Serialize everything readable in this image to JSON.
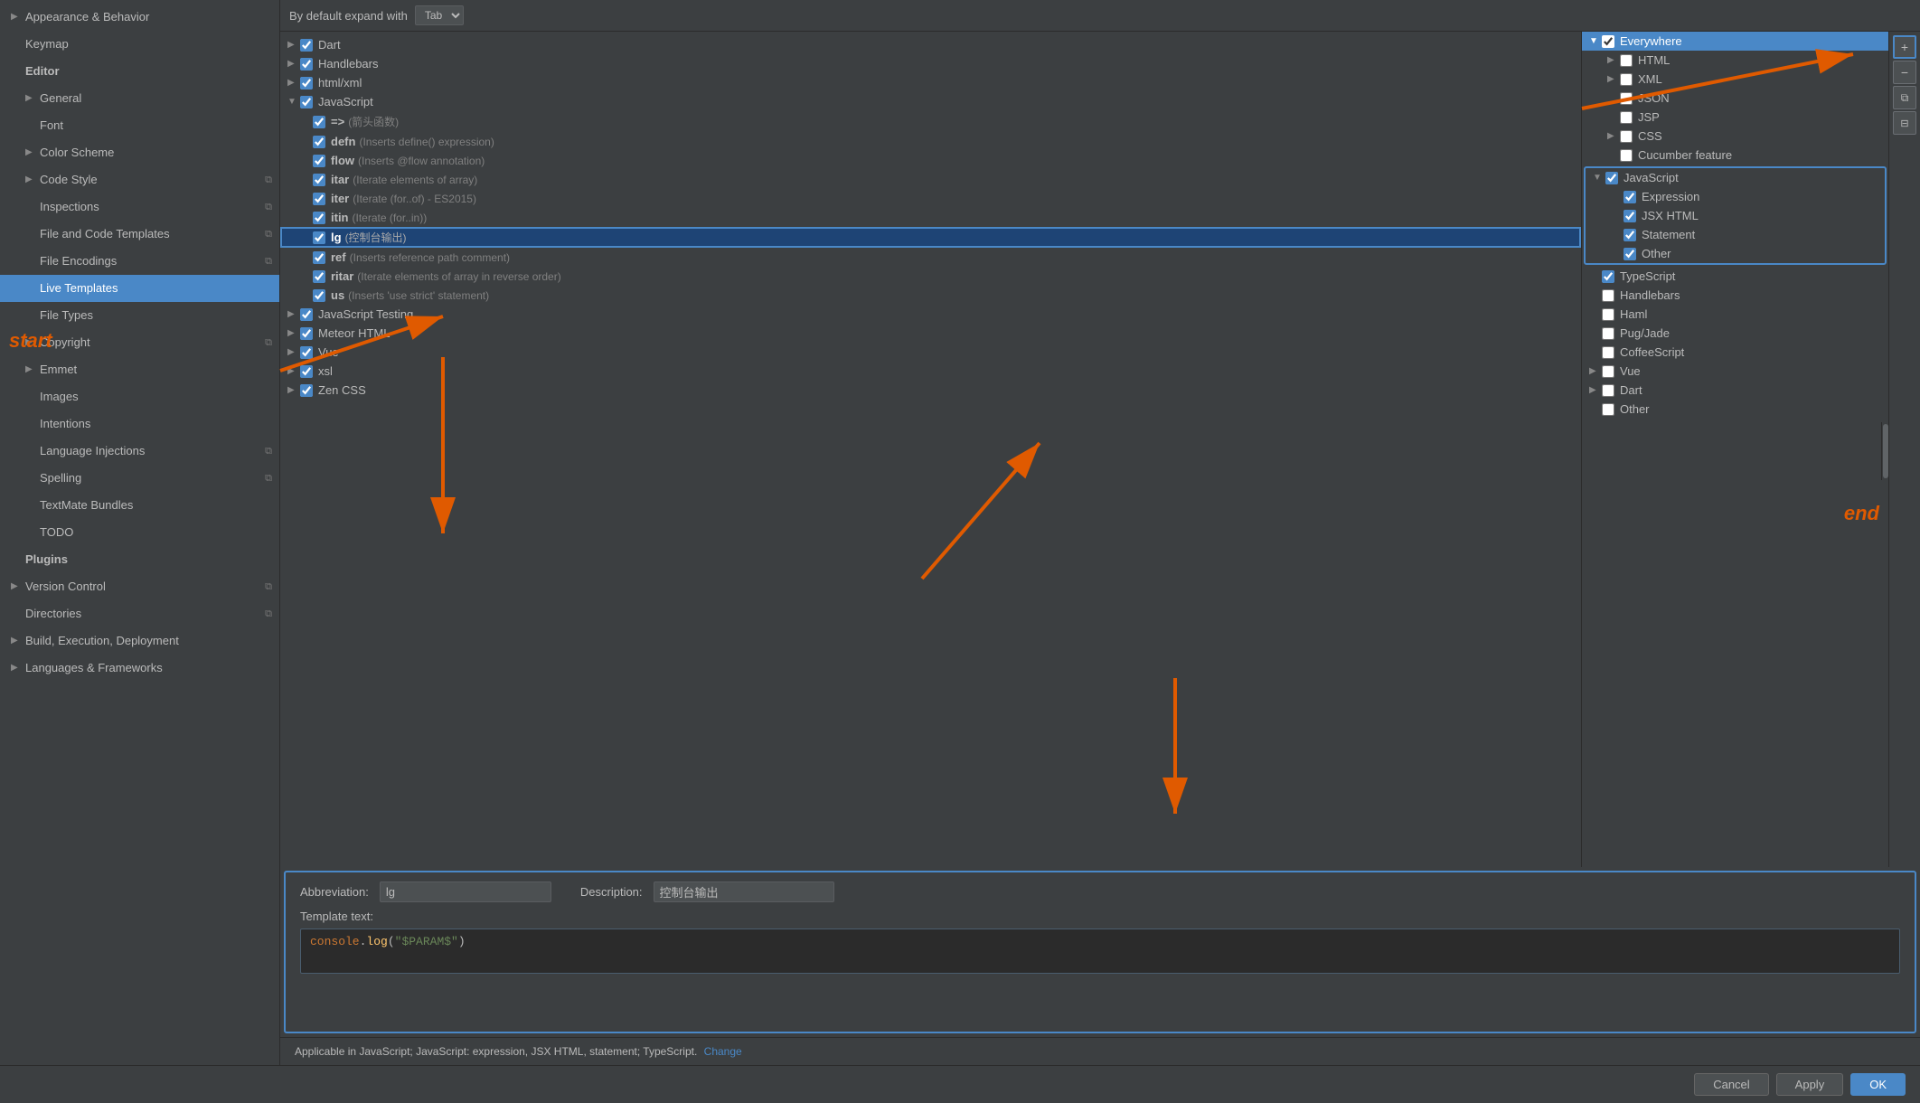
{
  "sidebar": {
    "items": [
      {
        "id": "appearance",
        "label": "Appearance & Behavior",
        "indent": 0,
        "arrow": "▶",
        "active": false
      },
      {
        "id": "keymap",
        "label": "Keymap",
        "indent": 0,
        "arrow": "",
        "active": false
      },
      {
        "id": "editor",
        "label": "Editor",
        "indent": 0,
        "arrow": "",
        "active": false,
        "bold": true
      },
      {
        "id": "general",
        "label": "General",
        "indent": 1,
        "arrow": "▶",
        "active": false
      },
      {
        "id": "font",
        "label": "Font",
        "indent": 1,
        "arrow": "",
        "active": false
      },
      {
        "id": "color-scheme",
        "label": "Color Scheme",
        "indent": 1,
        "arrow": "▶",
        "active": false
      },
      {
        "id": "code-style",
        "label": "Code Style",
        "indent": 1,
        "arrow": "▶",
        "active": false,
        "copy": true
      },
      {
        "id": "inspections",
        "label": "Inspections",
        "indent": 1,
        "arrow": "",
        "active": false,
        "copy": true
      },
      {
        "id": "file-templates",
        "label": "File and Code Templates",
        "indent": 1,
        "arrow": "",
        "active": false,
        "copy": true
      },
      {
        "id": "file-encodings",
        "label": "File Encodings",
        "indent": 1,
        "arrow": "",
        "active": false,
        "copy": true
      },
      {
        "id": "live-templates",
        "label": "Live Templates",
        "indent": 1,
        "arrow": "",
        "active": true
      },
      {
        "id": "file-types",
        "label": "File Types",
        "indent": 1,
        "arrow": "",
        "active": false
      },
      {
        "id": "copyright",
        "label": "Copyright",
        "indent": 1,
        "arrow": "▶",
        "active": false,
        "copy": true
      },
      {
        "id": "emmet",
        "label": "Emmet",
        "indent": 1,
        "arrow": "▶",
        "active": false
      },
      {
        "id": "images",
        "label": "Images",
        "indent": 1,
        "arrow": "",
        "active": false
      },
      {
        "id": "intentions",
        "label": "Intentions",
        "indent": 1,
        "arrow": "",
        "active": false
      },
      {
        "id": "language-injections",
        "label": "Language Injections",
        "indent": 1,
        "arrow": "",
        "active": false,
        "copy": true
      },
      {
        "id": "spelling",
        "label": "Spelling",
        "indent": 1,
        "arrow": "",
        "active": false,
        "copy": true
      },
      {
        "id": "textmate",
        "label": "TextMate Bundles",
        "indent": 1,
        "arrow": "",
        "active": false
      },
      {
        "id": "todo",
        "label": "TODO",
        "indent": 1,
        "arrow": "",
        "active": false
      },
      {
        "id": "plugins",
        "label": "Plugins",
        "indent": 0,
        "arrow": "",
        "active": false,
        "bold": true
      },
      {
        "id": "version-control",
        "label": "Version Control",
        "indent": 0,
        "arrow": "▶",
        "active": false,
        "copy": true
      },
      {
        "id": "directories",
        "label": "Directories",
        "indent": 0,
        "arrow": "",
        "active": false,
        "copy": true
      },
      {
        "id": "build",
        "label": "Build, Execution, Deployment",
        "indent": 0,
        "arrow": "▶",
        "active": false
      },
      {
        "id": "languages",
        "label": "Languages & Frameworks",
        "indent": 0,
        "arrow": "▶",
        "active": false
      }
    ]
  },
  "topbar": {
    "label": "By default expand with",
    "select_value": "Tab"
  },
  "template_groups": [
    {
      "id": "dart",
      "label": "Dart",
      "checked": true,
      "expanded": false
    },
    {
      "id": "handlebars",
      "label": "Handlebars",
      "checked": true,
      "expanded": false
    },
    {
      "id": "html-xml",
      "label": "html/xml",
      "checked": true,
      "expanded": false
    },
    {
      "id": "javascript",
      "label": "JavaScript",
      "checked": true,
      "expanded": true,
      "items": [
        {
          "abbr": "=>",
          "desc": "(箭头函数)",
          "checked": true,
          "selected": false
        },
        {
          "abbr": "defn",
          "desc": "(Inserts define() expression)",
          "checked": true,
          "selected": false
        },
        {
          "abbr": "flow",
          "desc": "(Inserts @flow annotation)",
          "checked": true,
          "selected": false
        },
        {
          "abbr": "itar",
          "desc": "(Iterate elements of array)",
          "checked": true,
          "selected": false
        },
        {
          "abbr": "iter",
          "desc": "(Iterate (for..of) - ES2015)",
          "checked": true,
          "selected": false
        },
        {
          "abbr": "itin",
          "desc": "(Iterate (for..in))",
          "checked": true,
          "selected": false
        },
        {
          "abbr": "lg",
          "desc": "(控制台输出)",
          "checked": true,
          "selected": true
        },
        {
          "abbr": "ref",
          "desc": "(Inserts reference path comment)",
          "checked": true,
          "selected": false
        },
        {
          "abbr": "ritar",
          "desc": "(Iterate elements of array in reverse order)",
          "checked": true,
          "selected": false
        },
        {
          "abbr": "us",
          "desc": "(Inserts 'use strict' statement)",
          "checked": true,
          "selected": false
        }
      ]
    },
    {
      "id": "js-testing",
      "label": "JavaScript Testing",
      "checked": true,
      "expanded": false
    },
    {
      "id": "meteor-html",
      "label": "Meteor HTML",
      "checked": true,
      "expanded": false
    },
    {
      "id": "vue",
      "label": "Vue",
      "checked": true,
      "expanded": false
    },
    {
      "id": "xsl",
      "label": "xsl",
      "checked": true,
      "expanded": false
    },
    {
      "id": "zen-css",
      "label": "Zen CSS",
      "checked": true,
      "expanded": false
    }
  ],
  "detail": {
    "abbreviation_label": "Abbreviation:",
    "abbreviation_value": "lg",
    "description_label": "Description:",
    "description_value": "控制台输出",
    "template_text_label": "Template text:",
    "template_text": "console.log(\"$PARAM$\")"
  },
  "applicable": {
    "text": "Applicable in JavaScript; JavaScript: expression, JSX HTML, statement; TypeScript.",
    "link_text": "Change"
  },
  "applicability_tree": [
    {
      "id": "everywhere",
      "label": "Everywhere",
      "checked": true,
      "expanded": true,
      "active": true,
      "children": [
        {
          "id": "html",
          "label": "HTML",
          "checked": false,
          "expanded": true
        },
        {
          "id": "xml",
          "label": "XML",
          "checked": false,
          "expanded": false
        },
        {
          "id": "json",
          "label": "JSON",
          "checked": false,
          "expanded": false
        },
        {
          "id": "jsp",
          "label": "JSP",
          "checked": false,
          "expanded": false
        },
        {
          "id": "css",
          "label": "CSS",
          "checked": false,
          "expanded": true
        },
        {
          "id": "cucumber",
          "label": "Cucumber feature",
          "checked": false,
          "expanded": false
        }
      ]
    },
    {
      "id": "javascript-ctx",
      "label": "JavaScript",
      "checked": true,
      "expanded": true,
      "children": [
        {
          "id": "expression",
          "label": "Expression",
          "checked": true,
          "expanded": false
        },
        {
          "id": "jsx-html",
          "label": "JSX HTML",
          "checked": true,
          "expanded": false
        },
        {
          "id": "statement",
          "label": "Statement",
          "checked": true,
          "expanded": false
        },
        {
          "id": "other",
          "label": "Other",
          "checked": true,
          "expanded": false
        }
      ]
    },
    {
      "id": "typescript",
      "label": "TypeScript",
      "checked": true,
      "expanded": false
    },
    {
      "id": "handlebars-ctx",
      "label": "Handlebars",
      "checked": false,
      "expanded": false
    },
    {
      "id": "haml",
      "label": "Haml",
      "checked": false,
      "expanded": false
    },
    {
      "id": "pug",
      "label": "Pug/Jade",
      "checked": false,
      "expanded": false
    },
    {
      "id": "coffeescript",
      "label": "CoffeeScript",
      "checked": false,
      "expanded": false
    },
    {
      "id": "vue-ctx",
      "label": "Vue",
      "checked": false,
      "expanded": true
    },
    {
      "id": "dart-ctx",
      "label": "Dart",
      "checked": false,
      "expanded": true
    },
    {
      "id": "other-ctx",
      "label": "Other",
      "checked": false,
      "expanded": false
    }
  ],
  "toolbar_buttons": [
    {
      "id": "add",
      "label": "+",
      "tooltip": "Add"
    },
    {
      "id": "remove",
      "label": "−",
      "tooltip": "Remove"
    },
    {
      "id": "copy",
      "label": "⧉",
      "tooltip": "Copy"
    },
    {
      "id": "expand",
      "label": "⊞",
      "tooltip": "Expand All"
    }
  ],
  "dialog_buttons": [
    {
      "id": "cancel",
      "label": "Cancel"
    },
    {
      "id": "apply",
      "label": "Apply"
    },
    {
      "id": "ok",
      "label": "OK"
    }
  ],
  "arrows": {
    "start_label": "start",
    "end_label": "end"
  }
}
